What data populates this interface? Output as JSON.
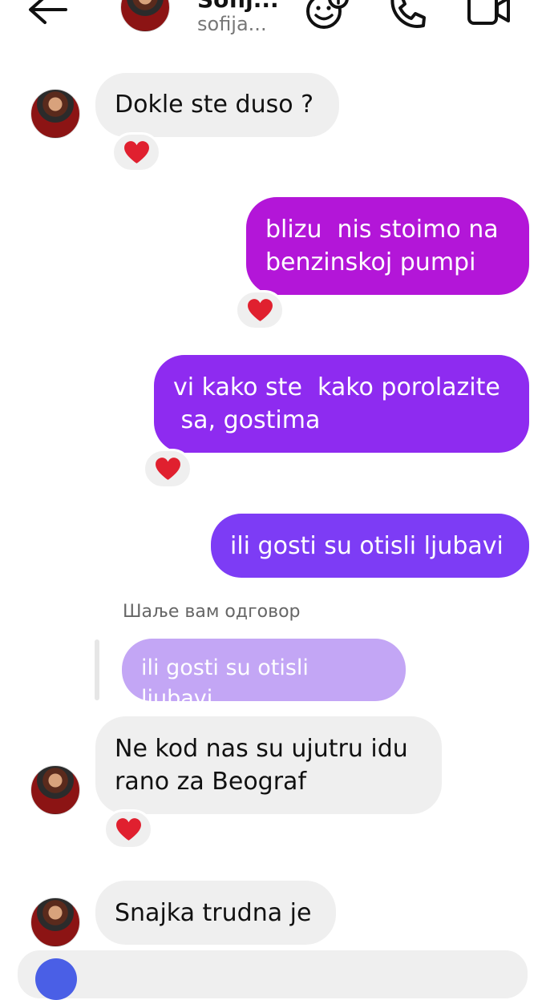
{
  "header": {
    "contact_name": "Sofij...",
    "contact_username": "sofija...",
    "icons": [
      "back-arrow-icon",
      "avatar",
      "add-effects-icon",
      "phone-icon",
      "video-camera-icon"
    ]
  },
  "messages": [
    {
      "direction": "incoming",
      "text": "Dokle ste duso ?",
      "reaction": "❤"
    },
    {
      "direction": "outgoing",
      "text": "blizu  nis stoimo na\nbenzinskoj pumpi",
      "reaction": "❤"
    },
    {
      "direction": "outgoing",
      "text": "vi kako ste  kako porolazite\n sa, gostima",
      "reaction": "❤"
    },
    {
      "direction": "outgoing",
      "text": "ili gosti su otisli ljubavi",
      "reaction": ""
    }
  ],
  "reply": {
    "label": "Шаље вам одговор",
    "quoted_text": "ili gosti su otisli ljubavi",
    "text": "Ne kod nas su ujutru idu\nrano za Beograf",
    "reaction": "❤"
  },
  "last_message": {
    "direction": "incoming",
    "text": "Snajka trudna je"
  },
  "colors": {
    "incoming_bubble": "#efefef",
    "outgoing_top": "#b316d8",
    "outgoing_mid": "#8e2bf0",
    "outgoing_bottom": "#7d3cf5",
    "quoted_bubble": "#c3a6f5",
    "heart": "#e0202f"
  }
}
